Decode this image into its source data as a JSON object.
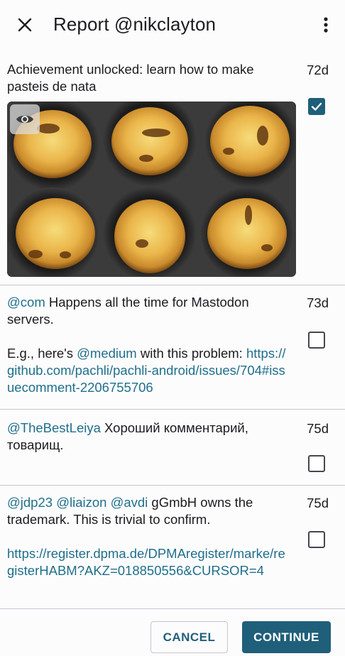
{
  "header": {
    "title": "Report @nikclayton"
  },
  "statuses": [
    {
      "paras": [
        [
          {
            "t": "Achievement unlocked: learn how to make pasteis de nata",
            "k": "text"
          }
        ]
      ],
      "age": "72d",
      "checked": true,
      "has_media": true
    },
    {
      "paras": [
        [
          {
            "t": "@com",
            "k": "mention"
          },
          {
            "t": " Happens all the time for Mastodon servers.",
            "k": "text"
          }
        ],
        [
          {
            "t": "E.g., here's ",
            "k": "text"
          },
          {
            "t": "@medium",
            "k": "mention"
          },
          {
            "t": " with this problem: ",
            "k": "text"
          },
          {
            "t": "https://github.com/pachli/pachli-android/issues/704#issuecomment-2206755706",
            "k": "link"
          }
        ]
      ],
      "age": "73d",
      "checked": false,
      "has_media": false
    },
    {
      "paras": [
        [
          {
            "t": "@TheBestLeiya",
            "k": "mention"
          },
          {
            "t": " Хороший комментарий, товарищ.",
            "k": "text"
          }
        ]
      ],
      "age": "75d",
      "checked": false,
      "has_media": false
    },
    {
      "paras": [
        [
          {
            "t": "@jdp23",
            "k": "mention"
          },
          {
            "t": " ",
            "k": "text"
          },
          {
            "t": "@liaizon",
            "k": "mention"
          },
          {
            "t": " ",
            "k": "text"
          },
          {
            "t": "@avdi",
            "k": "mention"
          },
          {
            "t": " gGmbH owns the trademark. This is trivial to confirm.",
            "k": "text"
          }
        ],
        [
          {
            "t": "https://register.dpma.de/DPMAregister/marke/registerHABM?AKZ=018850556&CURSOR=4",
            "k": "link"
          }
        ]
      ],
      "age": "75d",
      "checked": false,
      "has_media": false
    }
  ],
  "footer": {
    "cancel_label": "CANCEL",
    "continue_label": "CONTINUE"
  }
}
